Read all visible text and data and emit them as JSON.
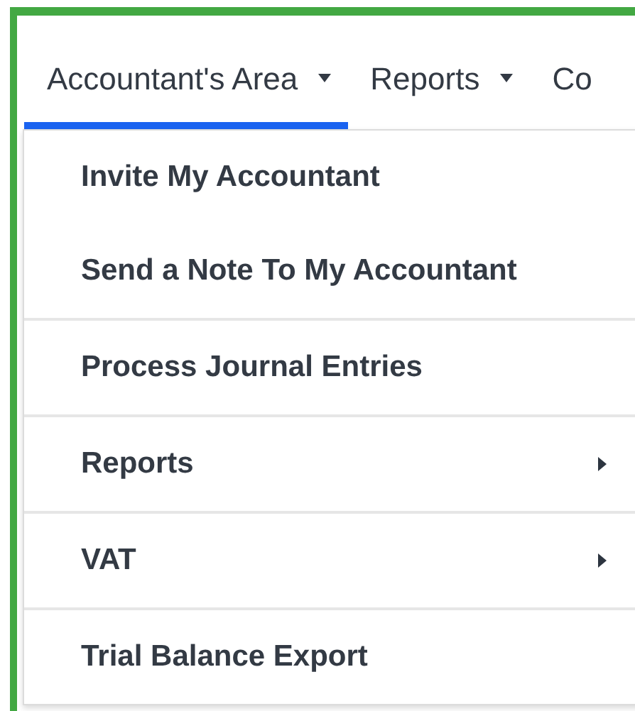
{
  "tabs": [
    {
      "label": "Accountant's Area",
      "selected": true,
      "has_caret": true
    },
    {
      "label": "Reports",
      "selected": false,
      "has_caret": true
    },
    {
      "label": "Co",
      "selected": false,
      "has_caret": false
    }
  ],
  "menu": {
    "groups": [
      {
        "items": [
          {
            "label": "Invite My Accountant",
            "kind": "action"
          },
          {
            "label": "Send a Note To My Accountant",
            "kind": "action"
          }
        ]
      },
      {
        "items": [
          {
            "label": "Process Journal Entries",
            "kind": "action"
          }
        ]
      },
      {
        "items": [
          {
            "label": "Reports",
            "kind": "submenu"
          }
        ]
      },
      {
        "items": [
          {
            "label": "VAT",
            "kind": "submenu"
          }
        ]
      },
      {
        "items": [
          {
            "label": "Trial Balance Export",
            "kind": "action"
          }
        ]
      }
    ]
  }
}
